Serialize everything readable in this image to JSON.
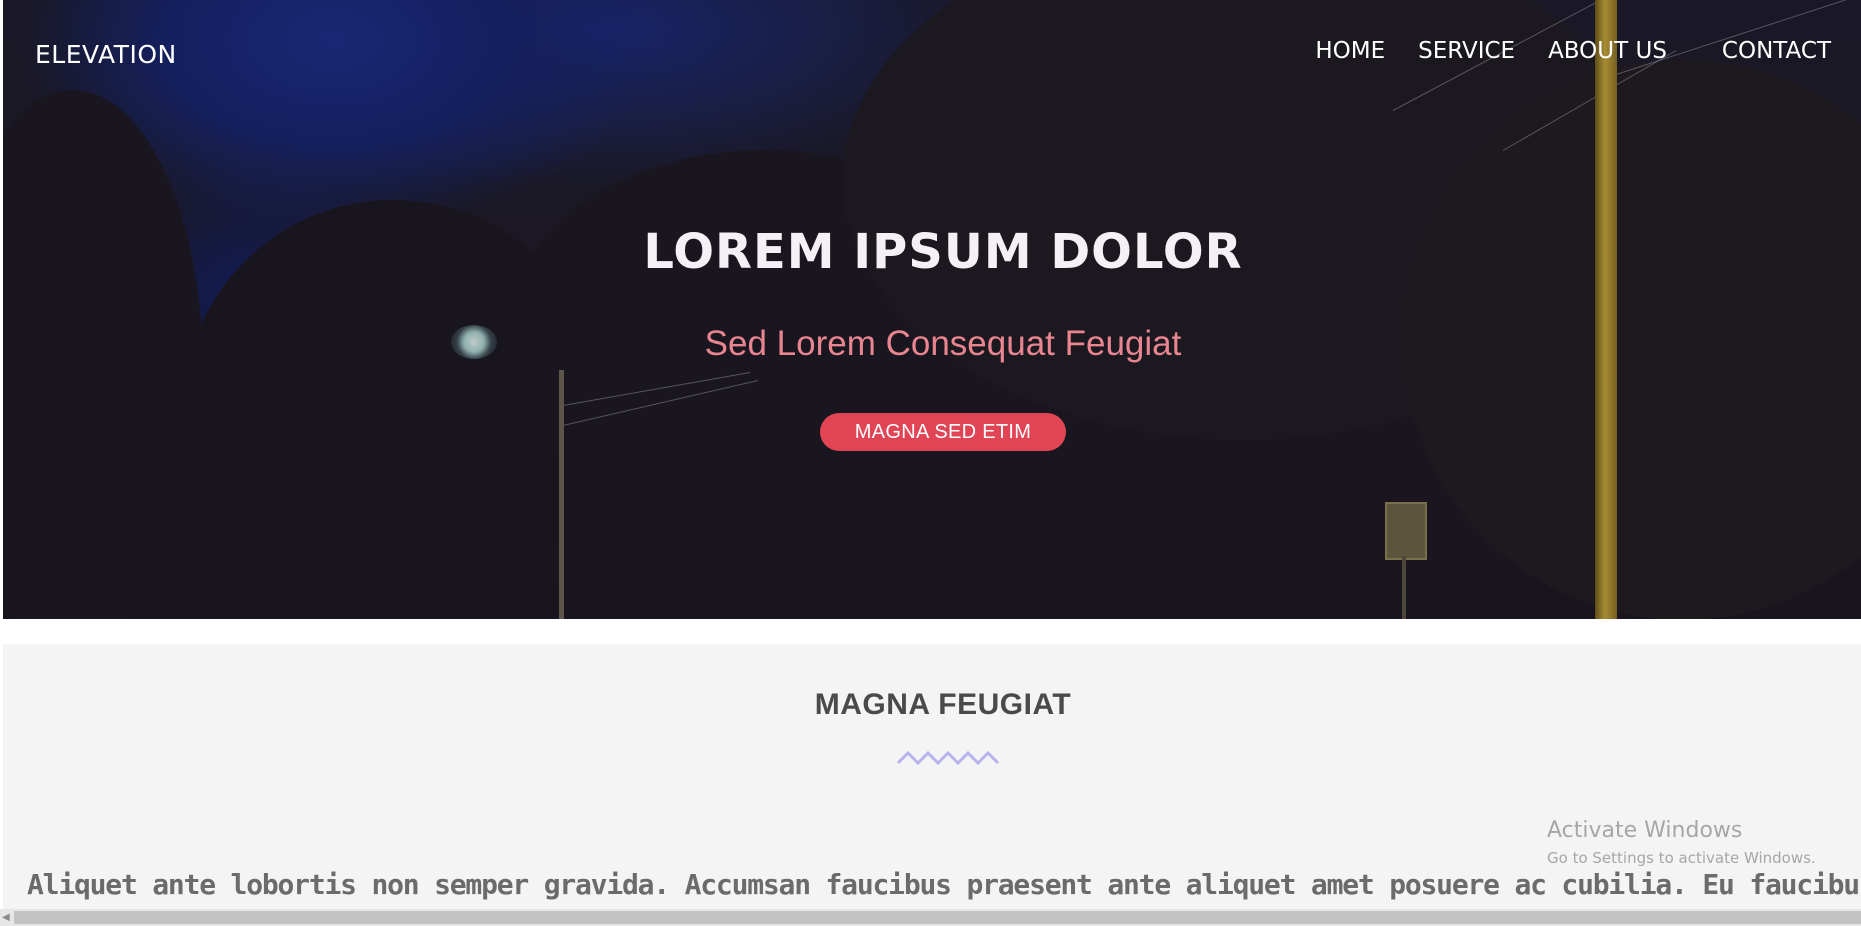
{
  "header": {
    "brand": "ELEVATION",
    "nav": [
      {
        "label": "HOME"
      },
      {
        "label": "SERVICE"
      },
      {
        "label": "ABOUT US"
      },
      {
        "label": "CONTACT"
      }
    ]
  },
  "hero": {
    "title": "LOREM IPSUM DOLOR",
    "subtitle": "Sed Lorem Consequat Feugiat",
    "button_label": "MAGNA SED ETIM"
  },
  "section": {
    "title": "MAGNA FEUGIAT",
    "body": "Aliquet ante lobortis non semper gravida. Accumsan faucibus praesent ante aliquet amet posuere ac cubilia. Eu faucibus"
  },
  "watermark": {
    "title": "Activate Windows",
    "subtitle": "Go to Settings to activate Windows."
  },
  "colors": {
    "accent": "#e04455",
    "subtitle": "#e98590",
    "zigzag": "#b7b4ee",
    "section_bg": "#f4f4f4"
  },
  "icons": {
    "divider": "zigzag-divider-icon",
    "scroll_left": "chevron-left-icon"
  }
}
